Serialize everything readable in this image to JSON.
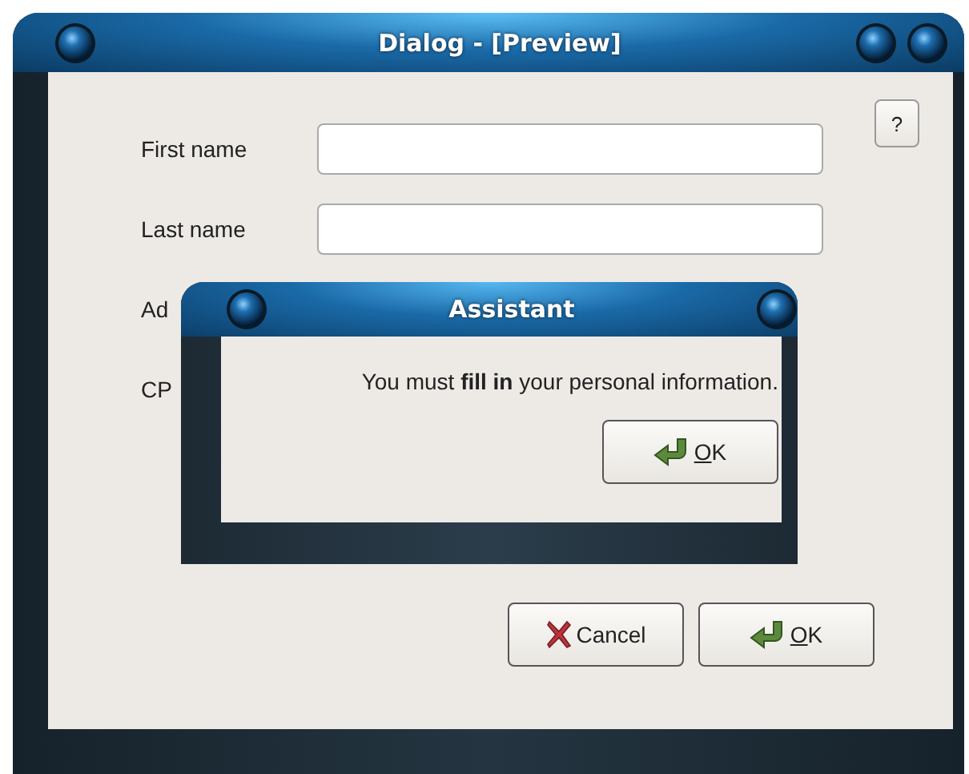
{
  "window": {
    "title": "Dialog - [Preview]"
  },
  "help_button": {
    "label": "?"
  },
  "form": {
    "rows": [
      {
        "label": "First name",
        "kind": "text-field"
      },
      {
        "label": "Last name",
        "kind": "text-field"
      },
      {
        "label": "Ad",
        "kind": "covered"
      },
      {
        "label": "CP",
        "kind": "covered"
      }
    ]
  },
  "buttons": [
    {
      "label": "Cancel",
      "kind": "cancel"
    },
    {
      "label": "OK",
      "kind": "ok",
      "mnemonic_underlined": true
    }
  ],
  "assistant": {
    "title": "Assistant",
    "message": "You must **fill in** your personal information.",
    "buttons": [
      {
        "label": "OK",
        "kind": "ok",
        "mnemonic_underlined": true
      }
    ]
  }
}
